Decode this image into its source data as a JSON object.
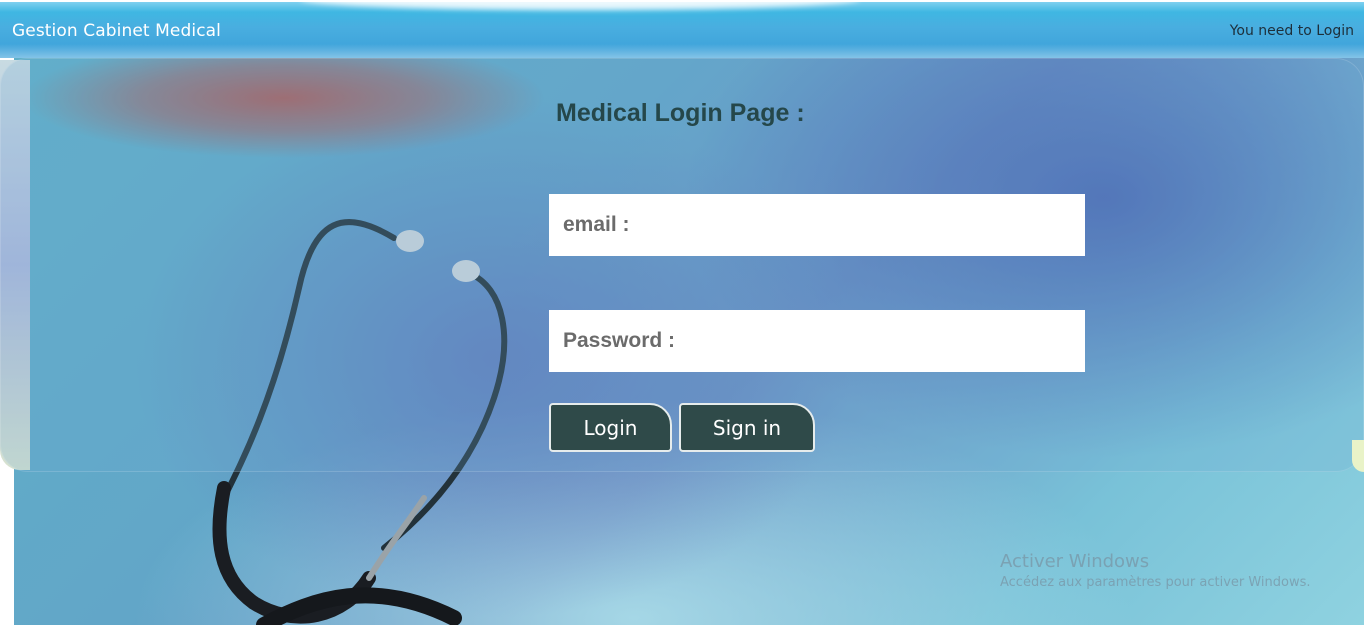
{
  "navbar": {
    "brand": "Gestion Cabinet Medical",
    "login_hint": "You need to Login"
  },
  "login_form": {
    "title": "Medical Login Page :",
    "email_placeholder": "email :",
    "password_placeholder": "Password :",
    "login_label": "Login",
    "signin_label": "Sign in"
  },
  "watermark": {
    "title": "Activer Windows",
    "subtitle": "Accédez aux paramètres pour activer Windows."
  },
  "colors": {
    "navbar": "#3fb7e2",
    "button_bg": "#2f4a49",
    "title_text": "#25474a"
  },
  "icons": {
    "background": "stethoscope-image"
  }
}
